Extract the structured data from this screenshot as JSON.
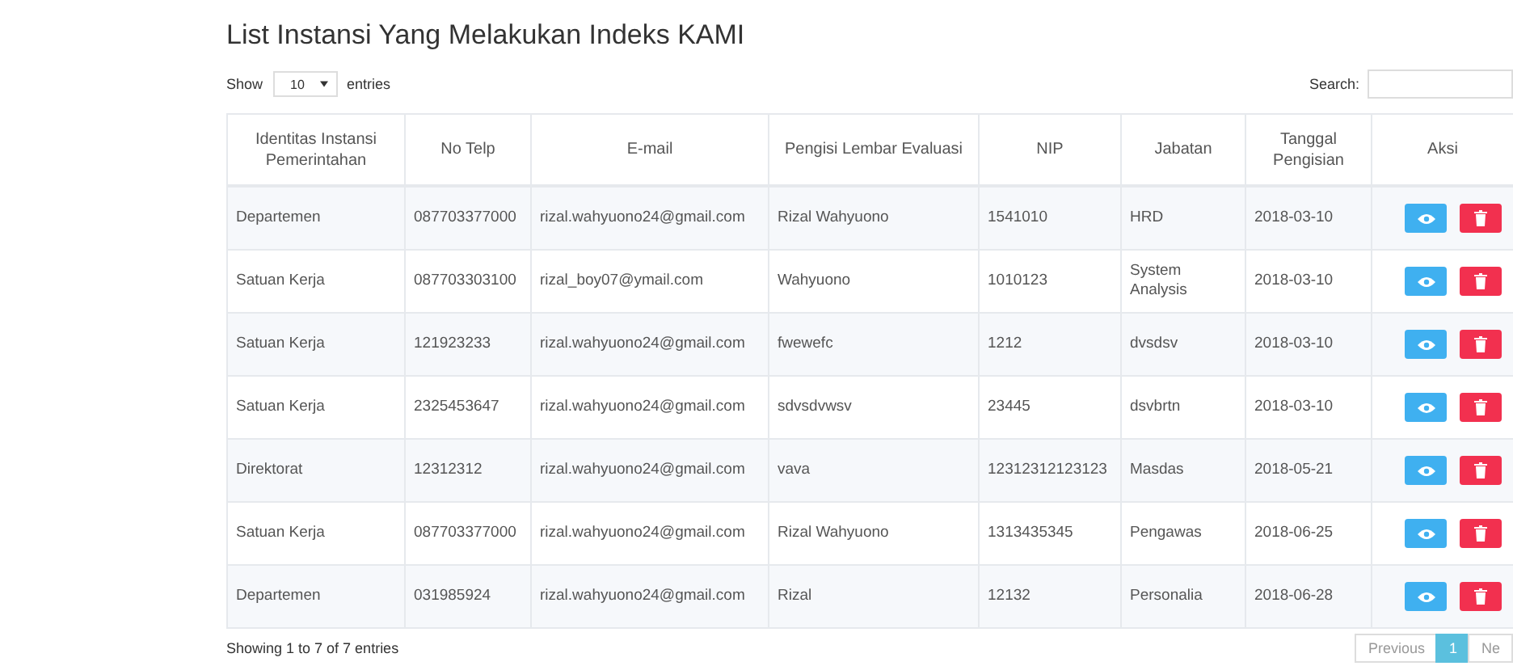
{
  "title": "List Instansi Yang Melakukan Indeks KAMI",
  "length_menu": {
    "show_label": "Show",
    "value": "10",
    "entries_label": "entries"
  },
  "search": {
    "label": "Search:"
  },
  "table": {
    "columns": [
      "Identitas Instansi Pemerintahan",
      "No Telp",
      "E-mail",
      "Pengisi Lembar Evaluasi",
      "NIP",
      "Jabatan",
      "Tanggal Pengisian",
      "Aksi"
    ],
    "rows": [
      {
        "cells": [
          "Departemen",
          "087703377000",
          "rizal.wahyuono24@gmail.com",
          "Rizal Wahyuono",
          "1541010",
          "HRD",
          "2018-03-10"
        ]
      },
      {
        "cells": [
          "Satuan Kerja",
          "087703303100",
          "rizal_boy07@ymail.com",
          "Wahyuono",
          "1010123",
          "System Analysis",
          "2018-03-10"
        ]
      },
      {
        "cells": [
          "Satuan Kerja",
          "121923233",
          "rizal.wahyuono24@gmail.com",
          "fwewefc",
          "1212",
          "dvsdsv",
          "2018-03-10"
        ]
      },
      {
        "cells": [
          "Satuan Kerja",
          "2325453647",
          "rizal.wahyuono24@gmail.com",
          "sdvsdvwsv",
          "23445",
          "dsvbrtn",
          "2018-03-10"
        ]
      },
      {
        "cells": [
          "Direktorat",
          "12312312",
          "rizal.wahyuono24@gmail.com",
          "vava",
          "12312312123123",
          "Masdas",
          "2018-05-21"
        ]
      },
      {
        "cells": [
          "Satuan Kerja",
          "087703377000",
          "rizal.wahyuono24@gmail.com",
          "Rizal Wahyuono",
          "1313435345",
          "Pengawas",
          "2018-06-25"
        ]
      },
      {
        "cells": [
          "Departemen",
          "031985924",
          "rizal.wahyuono24@gmail.com",
          "Rizal",
          "12132",
          "Personalia",
          "2018-06-28"
        ]
      }
    ]
  },
  "info": "Showing 1 to 7 of 7 entries",
  "pagination": [
    {
      "label": "Previous",
      "selected": false
    },
    {
      "label": "1",
      "selected": true
    },
    {
      "label": "Ne",
      "selected": false
    }
  ]
}
